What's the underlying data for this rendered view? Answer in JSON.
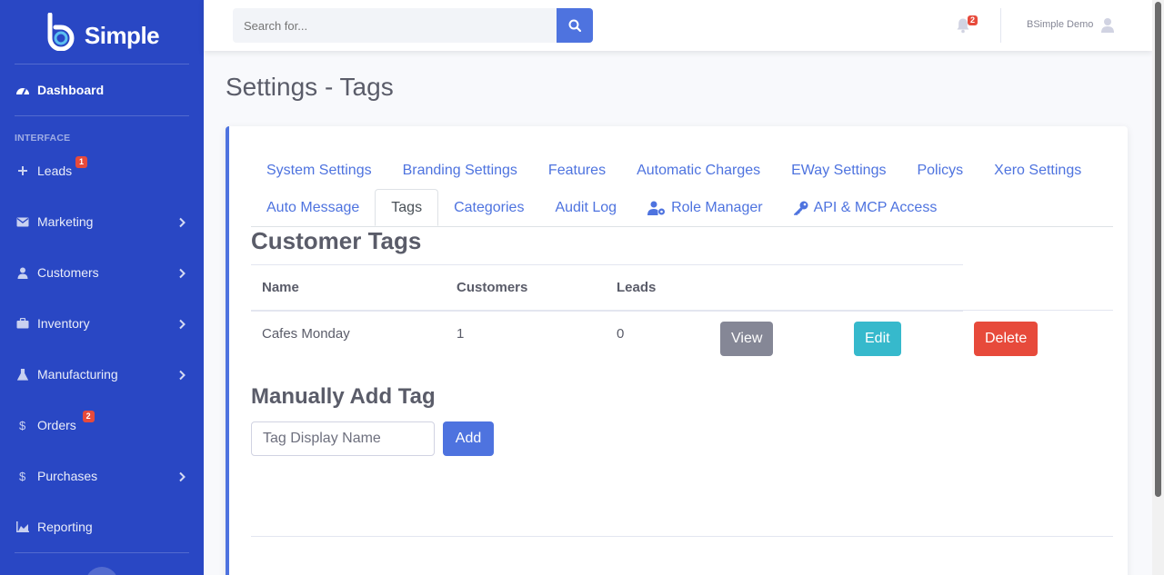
{
  "brand": {
    "name": "Simple"
  },
  "sidebar": {
    "dashboard": "Dashboard",
    "heading": "INTERFACE",
    "items": [
      {
        "label": "Leads",
        "badge": "1",
        "icon": "plus-icon",
        "chevron": false
      },
      {
        "label": "Marketing",
        "badge": "",
        "icon": "envelope-icon",
        "chevron": true
      },
      {
        "label": "Customers",
        "badge": "",
        "icon": "user-icon",
        "chevron": true
      },
      {
        "label": "Inventory",
        "badge": "",
        "icon": "briefcase-icon",
        "chevron": true
      },
      {
        "label": "Manufacturing",
        "badge": "",
        "icon": "flask-icon",
        "chevron": true
      },
      {
        "label": "Orders",
        "badge": "2",
        "icon": "dollar-icon",
        "chevron": false
      },
      {
        "label": "Purchases",
        "badge": "",
        "icon": "dollar-icon",
        "chevron": true
      },
      {
        "label": "Reporting",
        "badge": "",
        "icon": "chart-area-icon",
        "chevron": false
      }
    ]
  },
  "topbar": {
    "search_placeholder": "Search for...",
    "alerts_count": "2",
    "user_name": "BSimple Demo"
  },
  "page": {
    "title": "Settings - Tags"
  },
  "tabs_row1": [
    "System Settings",
    "Branding Settings",
    "Features",
    "Automatic Charges",
    "EWay Settings",
    "Policys",
    "Xero Settings"
  ],
  "tabs_row2": [
    {
      "label": "Auto Message",
      "icon": ""
    },
    {
      "label": "Tags",
      "icon": "",
      "active": true
    },
    {
      "label": "Categories",
      "icon": ""
    },
    {
      "label": "Audit Log",
      "icon": ""
    },
    {
      "label": "Role Manager",
      "icon": "user-cog-icon"
    },
    {
      "label": "API & MCP Access",
      "icon": "key-icon"
    }
  ],
  "customer_tags": {
    "title": "Customer Tags",
    "columns": [
      "Name",
      "Customers",
      "Leads"
    ],
    "rows": [
      {
        "name": "Cafes Monday",
        "customers": "1",
        "leads": "0"
      }
    ],
    "view_label": "View",
    "edit_label": "Edit",
    "delete_label": "Delete"
  },
  "add_tag": {
    "title": "Manually Add Tag",
    "placeholder": "Tag Display Name",
    "button": "Add"
  }
}
